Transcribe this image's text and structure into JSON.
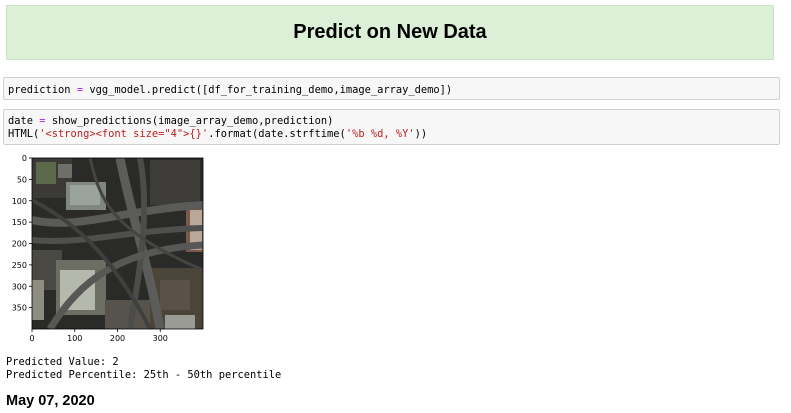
{
  "banner": {
    "title": "Predict on New Data"
  },
  "cells": {
    "predict": {
      "lhs": "prediction",
      "op": "=",
      "rhs": "vgg_model.predict([df_for_training_demo,image_array_demo])"
    },
    "show": {
      "line1_lhs": "date",
      "line1_op": "=",
      "line1_rhs": "show_predictions(image_array_demo,prediction)",
      "line2_pre": "HTML(",
      "line2_str": "'<strong><font size=\"4\">{}'",
      "line2_mid": ".format(date.strftime(",
      "line2_str2": "'%b %d, %Y'",
      "line2_post": "))"
    }
  },
  "plot": {
    "y_ticks": [
      "0",
      "50",
      "100",
      "150",
      "200",
      "250",
      "300",
      "350"
    ],
    "x_ticks": [
      "0",
      "100",
      "200",
      "300"
    ]
  },
  "output": {
    "predicted_value": "Predicted Value: 2",
    "predicted_percentile": "Predicted Percentile: 25th - 50th percentile"
  },
  "date": "May 07, 2020"
}
